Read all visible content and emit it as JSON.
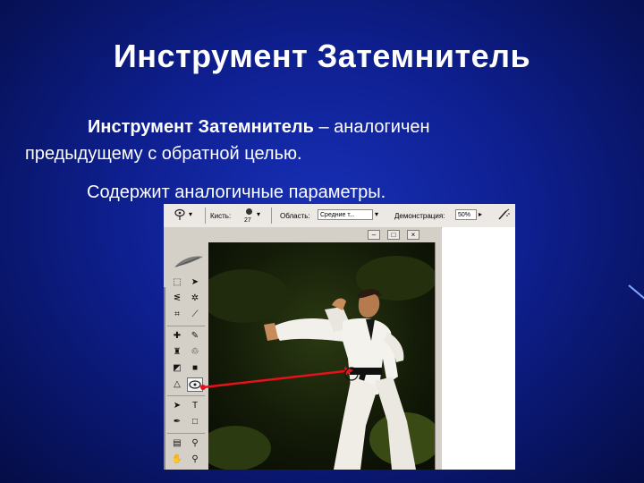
{
  "slide": {
    "title": "Инструмент Затемнитель",
    "para_bold": "Инструмент Затемнитель",
    "para_rest_line1": " – аналогичен",
    "para_line2": "предыдущему с обратной целью.",
    "para2": "Содержит аналогичные параметры."
  },
  "options_bar": {
    "brush_label": "Кисть:",
    "brush_size": "27",
    "range_label": "Область:",
    "range_value": "Средние т...",
    "exposure_label": "Демонстрация:",
    "exposure_value": "50%"
  },
  "window": {
    "minimize": "–",
    "maximize": "□",
    "close": "×"
  },
  "icons": [
    "dodge-tool-icon",
    "burn-tool-icon",
    "feather-logo-icon",
    "airbrush-icon"
  ],
  "colors": {
    "arrow": "#e8101a",
    "background": "#0e1f8f"
  }
}
